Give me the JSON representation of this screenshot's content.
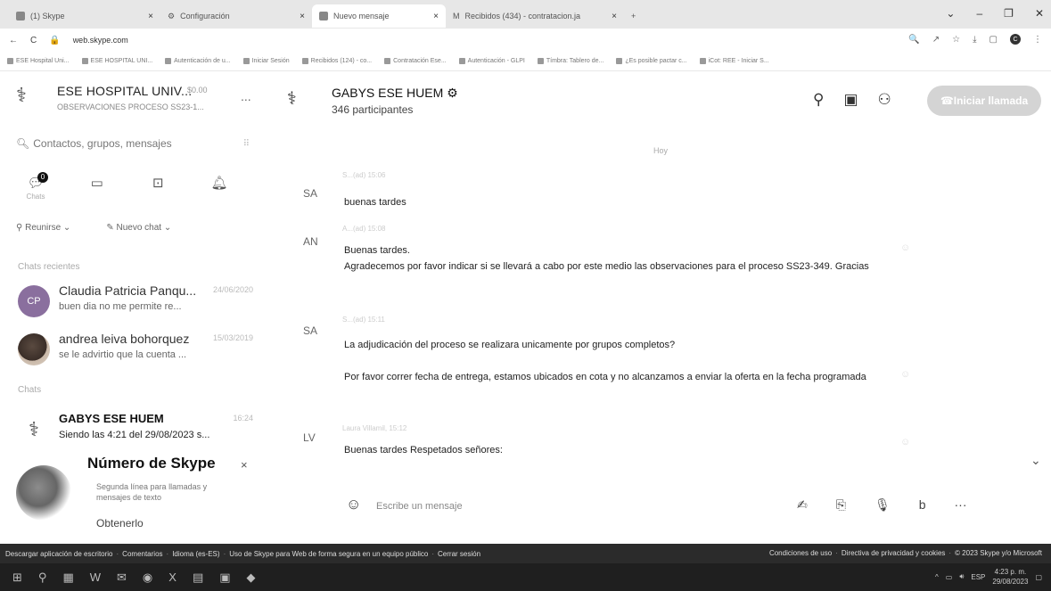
{
  "browser": {
    "tabs": [
      {
        "label": "(1) Skype",
        "active": false
      },
      {
        "label": "Configuración",
        "active": false
      },
      {
        "label": "Nuevo mensaje",
        "active": true
      },
      {
        "label": "Recibidos (434) - contratacion.ja",
        "active": false
      }
    ],
    "new_tab": "+",
    "url": "web.skype.com",
    "bookmarks": [
      "ESE Hospital Uni...",
      "ESE HOSPITAL UNI...",
      "Autenticación de u...",
      "Iniciar Sesión",
      "Recibidos (124) - co...",
      "Contratación Ese...",
      "Autenticación - GLPI",
      "Tímbra: Tablero de...",
      "¿Es posible pactar c...",
      "iCot: REE - Iniciar S..."
    ]
  },
  "profile": {
    "name": "ESE HOSPITAL UNIV...",
    "credit": "$0.00",
    "status": "OBSERVACIONES PROCESO SS23-1...",
    "more": "..."
  },
  "search": {
    "placeholder": "Contactos, grupos, mensajes"
  },
  "nav": {
    "chats_label": "Chats",
    "chats_badge": "0"
  },
  "actions": {
    "meet": "Reunirse",
    "new_chat": "Nuevo chat"
  },
  "sections": {
    "recent": "Chats recientes",
    "chats": "Chats"
  },
  "chats": [
    {
      "name": "Claudia Patricia Panqu...",
      "date": "24/06/2020",
      "preview": "buen dia no me permite re...",
      "initials": "CP"
    },
    {
      "name": "andrea leiva bohorquez",
      "date": "15/03/2019",
      "preview": "se le advirtio que la cuenta ..."
    },
    {
      "name": "GABYS ESE HUEM",
      "date": "16:24",
      "preview": "Siendo las 4:21 del 29/08/2023 s..."
    }
  ],
  "promo": {
    "title": "Número de Skype",
    "close": "×",
    "description": "Segunda línea para llamadas y mensajes de texto",
    "link": "Obtenerlo"
  },
  "conversation": {
    "title": "GABYS ESE HUEM",
    "participants": "346 participantes",
    "call_button": "Iniciar llamada",
    "day_separator": "Hoy",
    "messages": [
      {
        "initials": "SA",
        "meta": "S...(ad) 15:06",
        "text": "buenas tardes"
      },
      {
        "initials": "AN",
        "meta": "A...(ad) 15:08",
        "text": "Buenas tardes.\nAgradecemos por favor indicar si se llevará a cabo por este medio las observaciones para el proceso SS23-349. Gracias"
      },
      {
        "initials": "SA",
        "meta": "S...(ad) 15:11",
        "text": "La adjudicación del proceso se realizara unicamente por grupos completos?"
      },
      {
        "initials": "",
        "meta": "",
        "text": "Por favor correr fecha de entrega, estamos ubicados en cota y no alcanzamos a enviar la oferta en la fecha programada"
      },
      {
        "initials": "LV",
        "meta": "Laura Villamil, 15:12",
        "text": "Buenas tardes Respetados señores:"
      }
    ],
    "composer_placeholder": "Escribe un mensaje"
  },
  "footer": {
    "left": [
      "Descargar aplicación de escritorio",
      "Comentarios",
      "Idioma (es-ES)",
      "Uso de Skype para Web de forma segura en un equipo público",
      "Cerrar sesión"
    ],
    "right": [
      "Condiciones de uso",
      "Directiva de privacidad y cookies",
      "© 2023 Skype y/o Microsoft"
    ]
  },
  "taskbar": {
    "lang": "ESP",
    "time": "4:23 p. m.",
    "date": "29/08/2023"
  }
}
